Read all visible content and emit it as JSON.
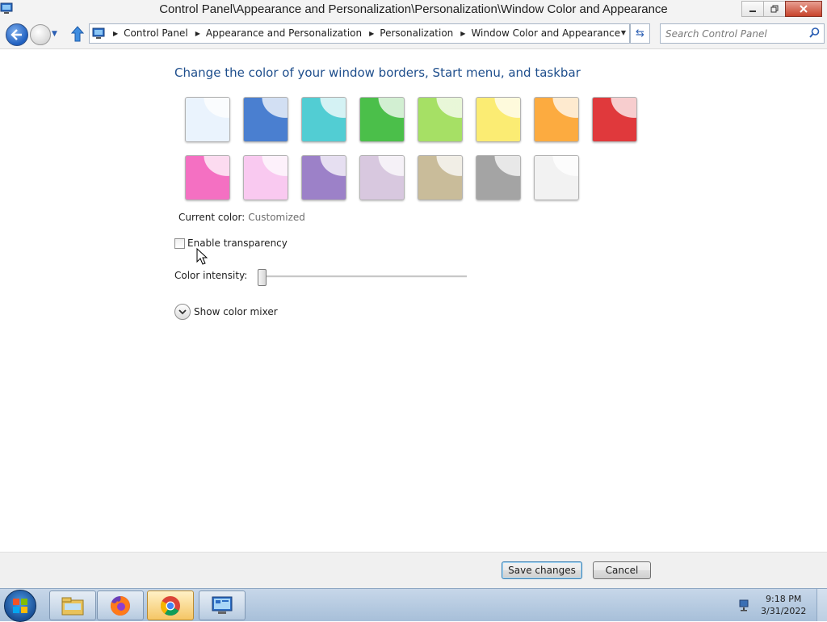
{
  "window": {
    "title": "Control Panel\\Appearance and Personalization\\Personalization\\Window Color and Appearance"
  },
  "address_bar": {
    "breadcrumbs": [
      "Control Panel",
      "Appearance and Personalization",
      "Personalization",
      "Window Color and Appearance"
    ]
  },
  "search": {
    "placeholder": "Search Control Panel"
  },
  "content": {
    "heading": "Change the color of your window borders, Start menu, and taskbar",
    "swatch_colors": [
      [
        "#eaf3fd",
        "#4a7fd0",
        "#52cdd3",
        "#4bbf4a",
        "#a6e065",
        "#fbec73",
        "#fcab40",
        "#e0393c"
      ],
      [
        "#f470c2",
        "#f9c9f0",
        "#9c81c8",
        "#d8c8df",
        "#c9bc9a",
        "#a4a4a4",
        "#f2f2f2"
      ]
    ],
    "current_color_label": "Current color:",
    "current_color_value": "Customized",
    "enable_transparency_label": "Enable transparency",
    "enable_transparency_checked": false,
    "color_intensity_label": "Color intensity:",
    "color_intensity_value": 0,
    "show_mixer_label": "Show color mixer"
  },
  "footer": {
    "save_label": "Save changes",
    "cancel_label": "Cancel"
  },
  "taskbar": {
    "items": [
      "file-explorer-icon",
      "firefox-icon",
      "chrome-icon",
      "control-panel-icon"
    ],
    "time": "9:18 PM",
    "date": "3/31/2022"
  }
}
